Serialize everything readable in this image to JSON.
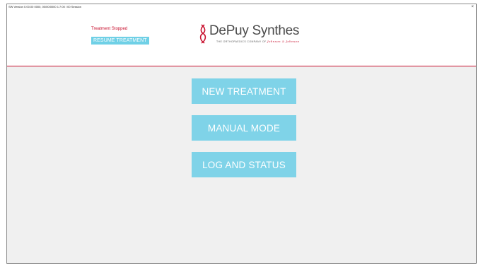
{
  "window": {
    "title": "SW Version 0.00.00 0000, 00/00/0000 1:7:00 / 00 Session"
  },
  "header": {
    "status_text": "Treatment Stopped",
    "resume_label": "RESUME TREATMENT",
    "logo": {
      "brand": "DePuy Synthes",
      "tagline": "THE ORTHOPAEDICS COMPANY OF",
      "tagline_parent": "Johnson & Johnson"
    }
  },
  "main": {
    "buttons": [
      {
        "label": "NEW TREATMENT"
      },
      {
        "label": "MANUAL MODE"
      },
      {
        "label": "LOG AND STATUS"
      }
    ]
  },
  "colors": {
    "accent": "#7fd3e8",
    "brand_red": "#c8102e",
    "background": "#f0f0f0"
  }
}
